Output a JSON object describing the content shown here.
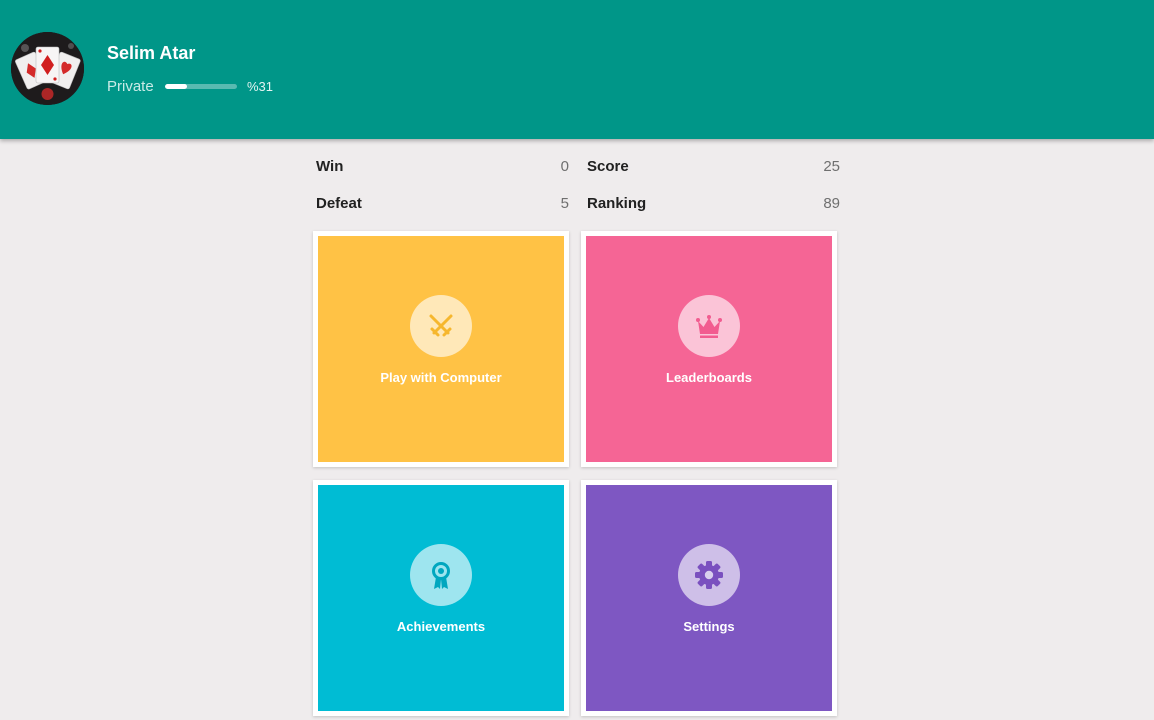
{
  "profile": {
    "name": "Selim Atar",
    "rank": "Private",
    "progress_text": "%31",
    "progress_value": 0.31
  },
  "stats": {
    "win": {
      "label": "Win",
      "value": "0"
    },
    "defeat": {
      "label": "Defeat",
      "value": "5"
    },
    "score": {
      "label": "Score",
      "value": "25"
    },
    "ranking": {
      "label": "Ranking",
      "value": "89"
    }
  },
  "tiles": [
    {
      "label": "Play with Computer",
      "icon": "crossed-swords-icon",
      "color": "#ffc245"
    },
    {
      "label": "Leaderboards",
      "icon": "crown-icon",
      "color": "#f56595"
    },
    {
      "label": "Achievements",
      "icon": "ribbon-award-icon",
      "color": "#00bcd4"
    },
    {
      "label": "Settings",
      "icon": "gear-icon",
      "color": "#7e57c2"
    }
  ],
  "colors": {
    "header": "#009688",
    "background": "#efeced"
  }
}
